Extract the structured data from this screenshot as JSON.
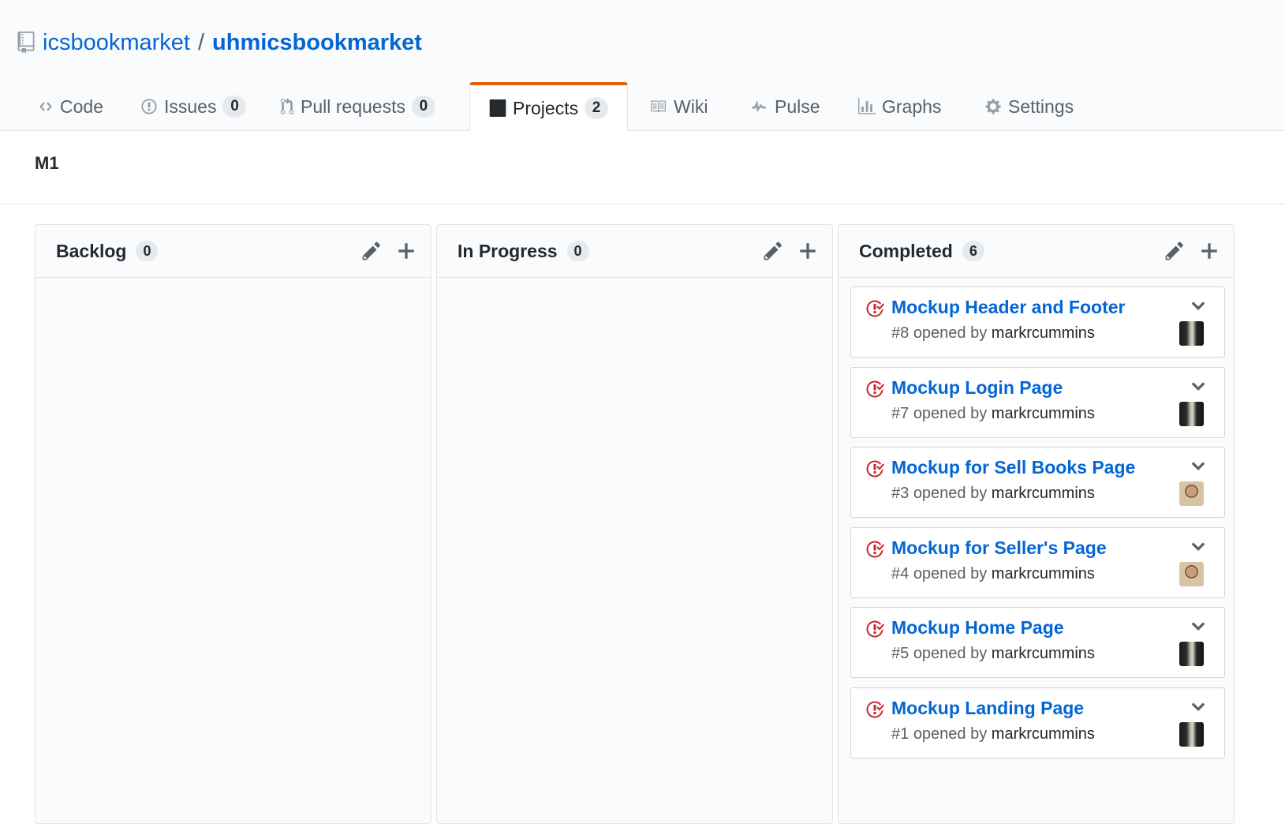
{
  "repo": {
    "owner": "icsbookmarket",
    "separator": "/",
    "name": "uhmicsbookmarket"
  },
  "tabs": [
    {
      "label": "Code",
      "icon": "code-icon"
    },
    {
      "label": "Issues",
      "count": "0",
      "icon": "issue-opened-icon"
    },
    {
      "label": "Pull requests",
      "count": "0",
      "icon": "git-pull-request-icon"
    },
    {
      "label": "Projects",
      "count": "2",
      "icon": "project-icon",
      "selected": true
    },
    {
      "label": "Wiki",
      "icon": "book-icon"
    },
    {
      "label": "Pulse",
      "icon": "pulse-icon"
    },
    {
      "label": "Graphs",
      "icon": "graph-icon"
    },
    {
      "label": "Settings",
      "icon": "gear-icon"
    }
  ],
  "project": {
    "name": "M1"
  },
  "columns": [
    {
      "title": "Backlog",
      "count": "0",
      "cards": []
    },
    {
      "title": "In Progress",
      "count": "0",
      "cards": []
    },
    {
      "title": "Completed",
      "count": "6",
      "cards": [
        {
          "title": "Mockup Header and Footer",
          "number": "#8",
          "opened_by": "opened by",
          "author": "markrcummins",
          "avatar": "dark"
        },
        {
          "title": "Mockup Login Page",
          "number": "#7",
          "opened_by": "opened by",
          "author": "markrcummins",
          "avatar": "dark"
        },
        {
          "title": "Mockup for Sell Books Page",
          "number": "#3",
          "opened_by": "opened by",
          "author": "markrcummins",
          "avatar": "light"
        },
        {
          "title": "Mockup for Seller's Page",
          "number": "#4",
          "opened_by": "opened by",
          "author": "markrcummins",
          "avatar": "light"
        },
        {
          "title": "Mockup Home Page",
          "number": "#5",
          "opened_by": "opened by",
          "author": "markrcummins",
          "avatar": "dark"
        },
        {
          "title": "Mockup Landing Page",
          "number": "#1",
          "opened_by": "opened by",
          "author": "markrcummins",
          "avatar": "dark"
        }
      ]
    }
  ],
  "colors": {
    "link": "#0366d6",
    "selected_tab_accent": "#e36209",
    "closed_issue_red": "#cb2431",
    "muted_text": "#586069"
  }
}
